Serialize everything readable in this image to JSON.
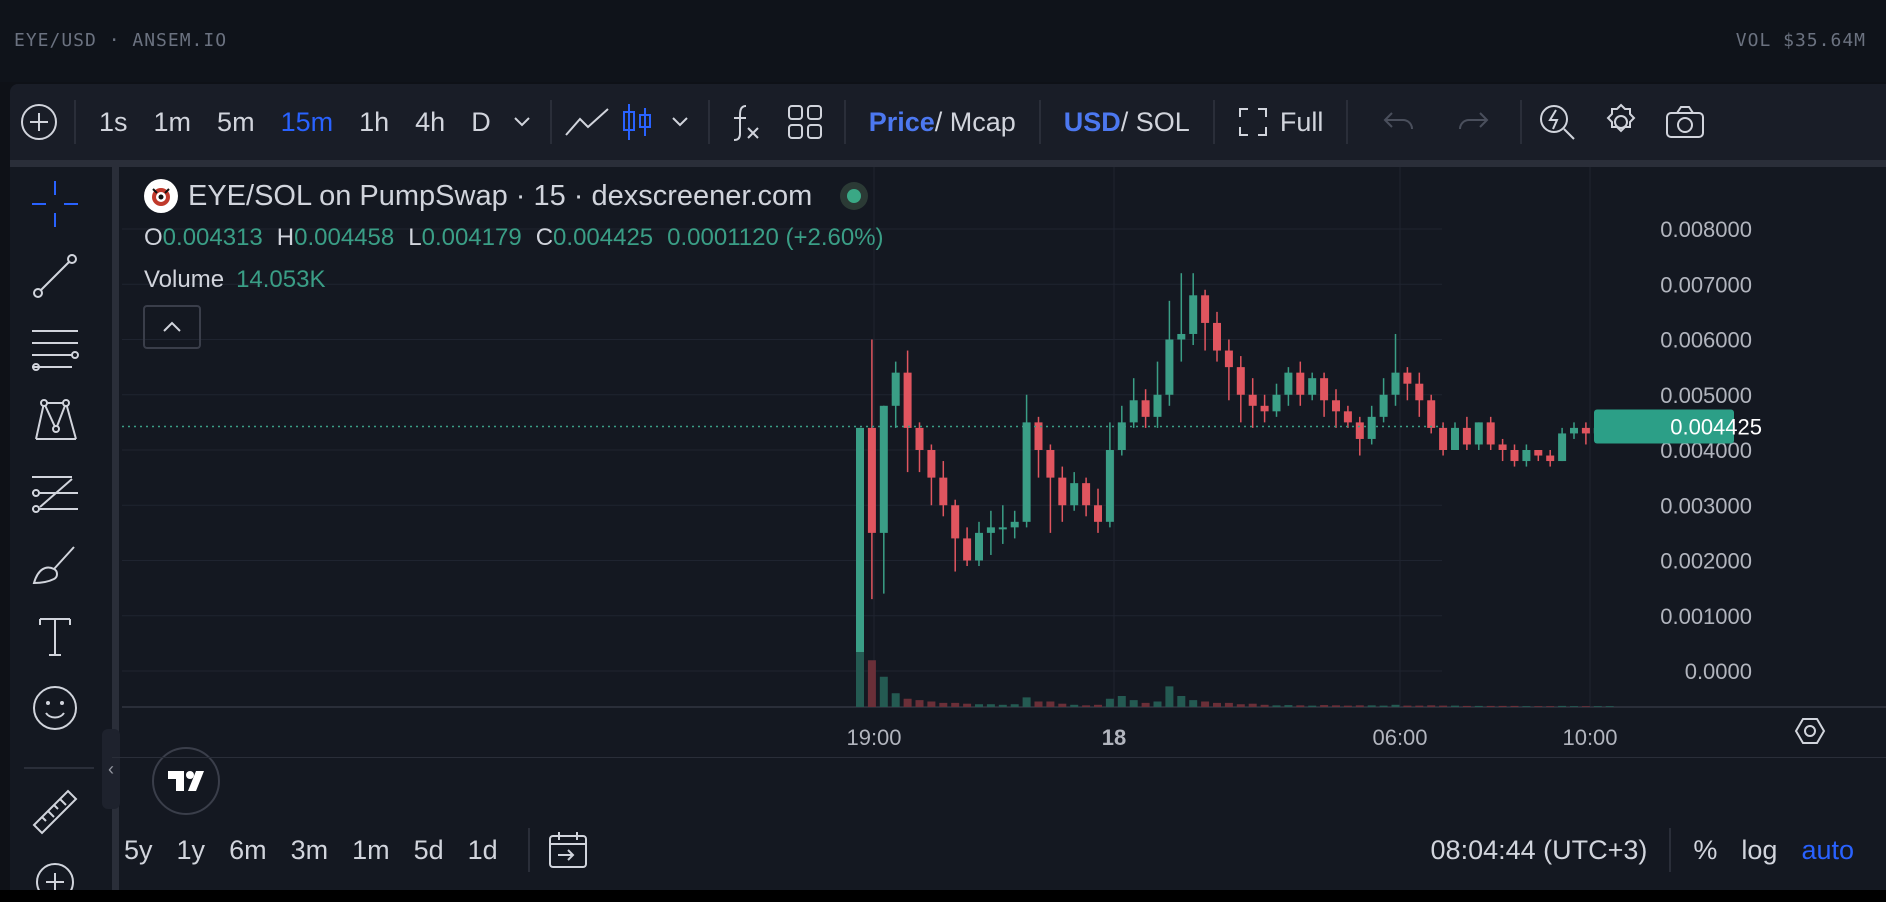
{
  "header": {
    "pair": "EYE/USD · ANSEM.IO",
    "volume": "VOL $35.64M"
  },
  "toolbar": {
    "intervals": [
      "1s",
      "1m",
      "5m",
      "15m",
      "1h",
      "4h",
      "D"
    ],
    "active_interval": "15m",
    "price_label": "Price",
    "mcap_label": " / Mcap",
    "usd_label": "USD",
    "sol_label": " / SOL",
    "full_label": "Full",
    "icons": [
      "add-icon",
      "chevron-down-icon",
      "line-chart-icon",
      "candlestick-icon",
      "indicators-icon",
      "layout-icon",
      "undo-icon",
      "redo-icon",
      "quick-search-icon",
      "settings-icon",
      "camera-icon"
    ]
  },
  "left_tools": [
    "crosshair-icon",
    "trendline-icon",
    "horizontal-lines-icon",
    "pattern-icon",
    "prediction-icon",
    "brush-icon",
    "text-icon",
    "emoji-icon",
    "ruler-icon",
    "zoom-in-icon"
  ],
  "legend": {
    "title": "EYE/SOL on PumpSwap · 15 · dexscreener.com",
    "o_label": "O",
    "o": "0.004313",
    "h_label": "H",
    "h": "0.004458",
    "l_label": "L",
    "l": "0.004179",
    "c_label": "C",
    "c": "0.004425",
    "change": "0.0001120 (+2.60%)",
    "volume_label": "Volume",
    "volume": "14.053K"
  },
  "chart_data": {
    "type": "candlestick",
    "y_ticks": [
      "0.008000",
      "0.007000",
      "0.006000",
      "0.005000",
      "0.004000",
      "0.003000",
      "0.002000",
      "0.001000",
      "0.0000"
    ],
    "ylim": [
      0,
      0.008
    ],
    "x_ticks": [
      "19:00",
      "18",
      "06:00",
      "10:00"
    ],
    "last_price": "0.004425",
    "candles": [
      [
        0.0,
        0.0044,
        0.0,
        0.0044,
        2.0
      ],
      [
        0.0044,
        0.0025,
        0.0013,
        0.006,
        1.7
      ],
      [
        0.0025,
        0.0048,
        0.0014,
        0.0048,
        1.1
      ],
      [
        0.0048,
        0.0054,
        0.0044,
        0.0056,
        0.5
      ],
      [
        0.0054,
        0.0044,
        0.0036,
        0.0058,
        0.3
      ],
      [
        0.0044,
        0.004,
        0.0036,
        0.0045,
        0.25
      ],
      [
        0.004,
        0.0035,
        0.003,
        0.0041,
        0.2
      ],
      [
        0.0035,
        0.003,
        0.0028,
        0.0038,
        0.15
      ],
      [
        0.003,
        0.0024,
        0.0018,
        0.0031,
        0.15
      ],
      [
        0.0024,
        0.002,
        0.0019,
        0.0026,
        0.12
      ],
      [
        0.002,
        0.0025,
        0.0019,
        0.0027,
        0.1
      ],
      [
        0.0025,
        0.0026,
        0.0021,
        0.0029,
        0.1
      ],
      [
        0.0026,
        0.0026,
        0.0023,
        0.003,
        0.08
      ],
      [
        0.0026,
        0.0027,
        0.0024,
        0.0029,
        0.1
      ],
      [
        0.0027,
        0.0045,
        0.0026,
        0.005,
        0.35
      ],
      [
        0.0045,
        0.004,
        0.0035,
        0.0046,
        0.2
      ],
      [
        0.004,
        0.0035,
        0.0025,
        0.0041,
        0.2
      ],
      [
        0.0035,
        0.003,
        0.0027,
        0.0037,
        0.12
      ],
      [
        0.003,
        0.0034,
        0.0029,
        0.0036,
        0.08
      ],
      [
        0.0034,
        0.003,
        0.0028,
        0.0035,
        0.06
      ],
      [
        0.003,
        0.0027,
        0.0025,
        0.0033,
        0.08
      ],
      [
        0.0027,
        0.004,
        0.0026,
        0.0045,
        0.3
      ],
      [
        0.004,
        0.0045,
        0.0039,
        0.0048,
        0.4
      ],
      [
        0.0045,
        0.0049,
        0.0044,
        0.0053,
        0.25
      ],
      [
        0.0049,
        0.0046,
        0.0044,
        0.0051,
        0.15
      ],
      [
        0.0046,
        0.005,
        0.0044,
        0.0056,
        0.2
      ],
      [
        0.005,
        0.006,
        0.0048,
        0.0067,
        0.75
      ],
      [
        0.006,
        0.0061,
        0.0056,
        0.0072,
        0.4
      ],
      [
        0.0061,
        0.0068,
        0.0059,
        0.0072,
        0.25
      ],
      [
        0.0068,
        0.0063,
        0.0058,
        0.0069,
        0.2
      ],
      [
        0.0063,
        0.0058,
        0.0056,
        0.0065,
        0.15
      ],
      [
        0.0058,
        0.0055,
        0.0049,
        0.006,
        0.15
      ],
      [
        0.0055,
        0.005,
        0.0045,
        0.0057,
        0.1
      ],
      [
        0.005,
        0.0048,
        0.0044,
        0.0053,
        0.12
      ],
      [
        0.0048,
        0.0047,
        0.0045,
        0.005,
        0.08
      ],
      [
        0.0047,
        0.005,
        0.0046,
        0.0052,
        0.06
      ],
      [
        0.005,
        0.0054,
        0.0048,
        0.0055,
        0.07
      ],
      [
        0.0054,
        0.005,
        0.0048,
        0.0056,
        0.06
      ],
      [
        0.005,
        0.0053,
        0.0049,
        0.0054,
        0.05
      ],
      [
        0.0053,
        0.0049,
        0.0046,
        0.0054,
        0.07
      ],
      [
        0.0049,
        0.0047,
        0.0044,
        0.0051,
        0.06
      ],
      [
        0.0047,
        0.0045,
        0.0044,
        0.0048,
        0.05
      ],
      [
        0.0045,
        0.0042,
        0.0039,
        0.0046,
        0.06
      ],
      [
        0.0042,
        0.0046,
        0.0041,
        0.0048,
        0.06
      ],
      [
        0.0046,
        0.005,
        0.0045,
        0.0053,
        0.05
      ],
      [
        0.005,
        0.0054,
        0.0048,
        0.0061,
        0.08
      ],
      [
        0.0054,
        0.0052,
        0.0049,
        0.0055,
        0.05
      ],
      [
        0.0052,
        0.0049,
        0.0046,
        0.0054,
        0.05
      ],
      [
        0.0049,
        0.0044,
        0.0043,
        0.005,
        0.06
      ],
      [
        0.0044,
        0.004,
        0.0039,
        0.0045,
        0.05
      ],
      [
        0.004,
        0.0044,
        0.004,
        0.0045,
        0.05
      ],
      [
        0.0044,
        0.0041,
        0.004,
        0.0046,
        0.04
      ],
      [
        0.0041,
        0.0045,
        0.004,
        0.0045,
        0.04
      ],
      [
        0.0045,
        0.0041,
        0.004,
        0.0046,
        0.04
      ],
      [
        0.0041,
        0.004,
        0.0038,
        0.0042,
        0.04
      ],
      [
        0.004,
        0.0038,
        0.0037,
        0.0041,
        0.04
      ],
      [
        0.0038,
        0.004,
        0.0037,
        0.0041,
        0.03
      ],
      [
        0.004,
        0.0039,
        0.0038,
        0.004,
        0.03
      ],
      [
        0.0039,
        0.0038,
        0.0037,
        0.004,
        0.03
      ],
      [
        0.0038,
        0.0043,
        0.0038,
        0.0044,
        0.04
      ],
      [
        0.0043,
        0.0044,
        0.0042,
        0.0045,
        0.03
      ],
      [
        0.0044,
        0.0043,
        0.0041,
        0.0045,
        0.03
      ],
      [
        0.0043,
        0.0044,
        0.0042,
        0.0045,
        0.03
      ],
      [
        0.0044,
        0.0045,
        0.0043,
        0.0045,
        0.03
      ]
    ]
  },
  "bottom": {
    "ranges": [
      "5y",
      "1y",
      "6m",
      "3m",
      "1m",
      "5d",
      "1d"
    ],
    "time": "08:04:44 (UTC+3)",
    "percent": "%",
    "log": "log",
    "auto": "auto"
  },
  "colors": {
    "up": "#26a69a",
    "down": "#ef5350",
    "accent": "#2962ff",
    "bg": "#141821"
  }
}
